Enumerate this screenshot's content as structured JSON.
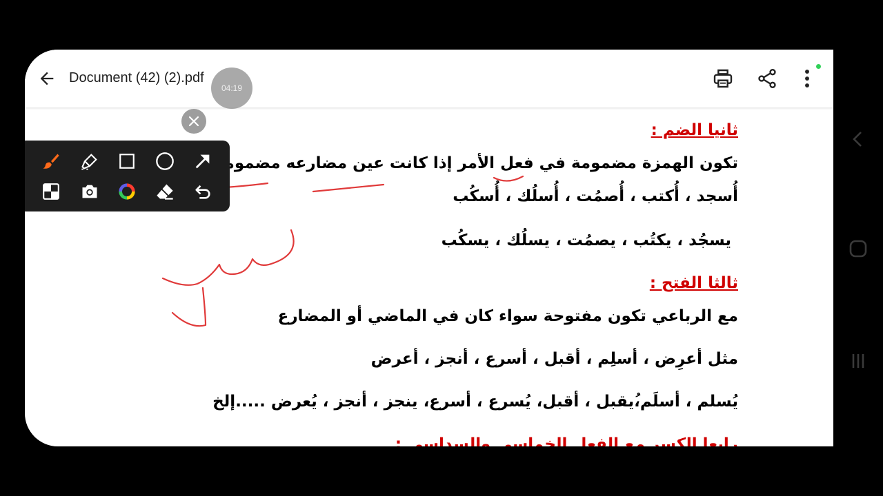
{
  "app_bar": {
    "title": "Document (42) (2).pdf",
    "recording_time": "04:19",
    "icons": [
      "back-arrow-icon",
      "print-icon",
      "share-icon",
      "more-vert-icon"
    ]
  },
  "toolbar": {
    "tools": [
      "brush-icon",
      "highlighter-icon",
      "rectangle-icon",
      "circle-icon",
      "arrow-icon",
      "mosaic-icon",
      "camera-icon",
      "color-wheel-icon",
      "eraser-icon",
      "undo-icon"
    ],
    "accent_color": "#ff6a1a"
  },
  "document": {
    "heading_damma": "ثانيا الضم :",
    "line_1": "تكون الهمزة مضمومة في فعل الأمر إذا كانت عين مضارعه مضمومة مثل :",
    "line_2": "أُسجد ، أُكتب ، أُصمُت ، أُسلُك ، أُسكُب",
    "line_3": "يسجُد ، يكتُب ، يصمُت ، يسلُك ، يسكُب",
    "heading_fatha": "ثالثا الفتح :",
    "line_4": "مع الرباعي تكون مفتوحة  سواء كان في الماضي أو المضارع",
    "line_5": "مثل أعرِض ، أسلِم ، أقبل ، أسرع  ،  أنجز ، أعرض",
    "line_6": "يُسلم ، أسلَم،ُيقبل ، أقبل، يُسرع ، أسرع، ينجز ، أنجز ، يُعرض .....إلخ",
    "line_7_partial": "رابعا الكسر مع الفعل الخماسي والسداسي :",
    "heading_color": "#d00000"
  },
  "annotation": {
    "ink_color": "#e03a3a"
  },
  "system_nav": {
    "icons": [
      "nav-back-icon",
      "nav-home-icon",
      "nav-recents-icon"
    ]
  }
}
